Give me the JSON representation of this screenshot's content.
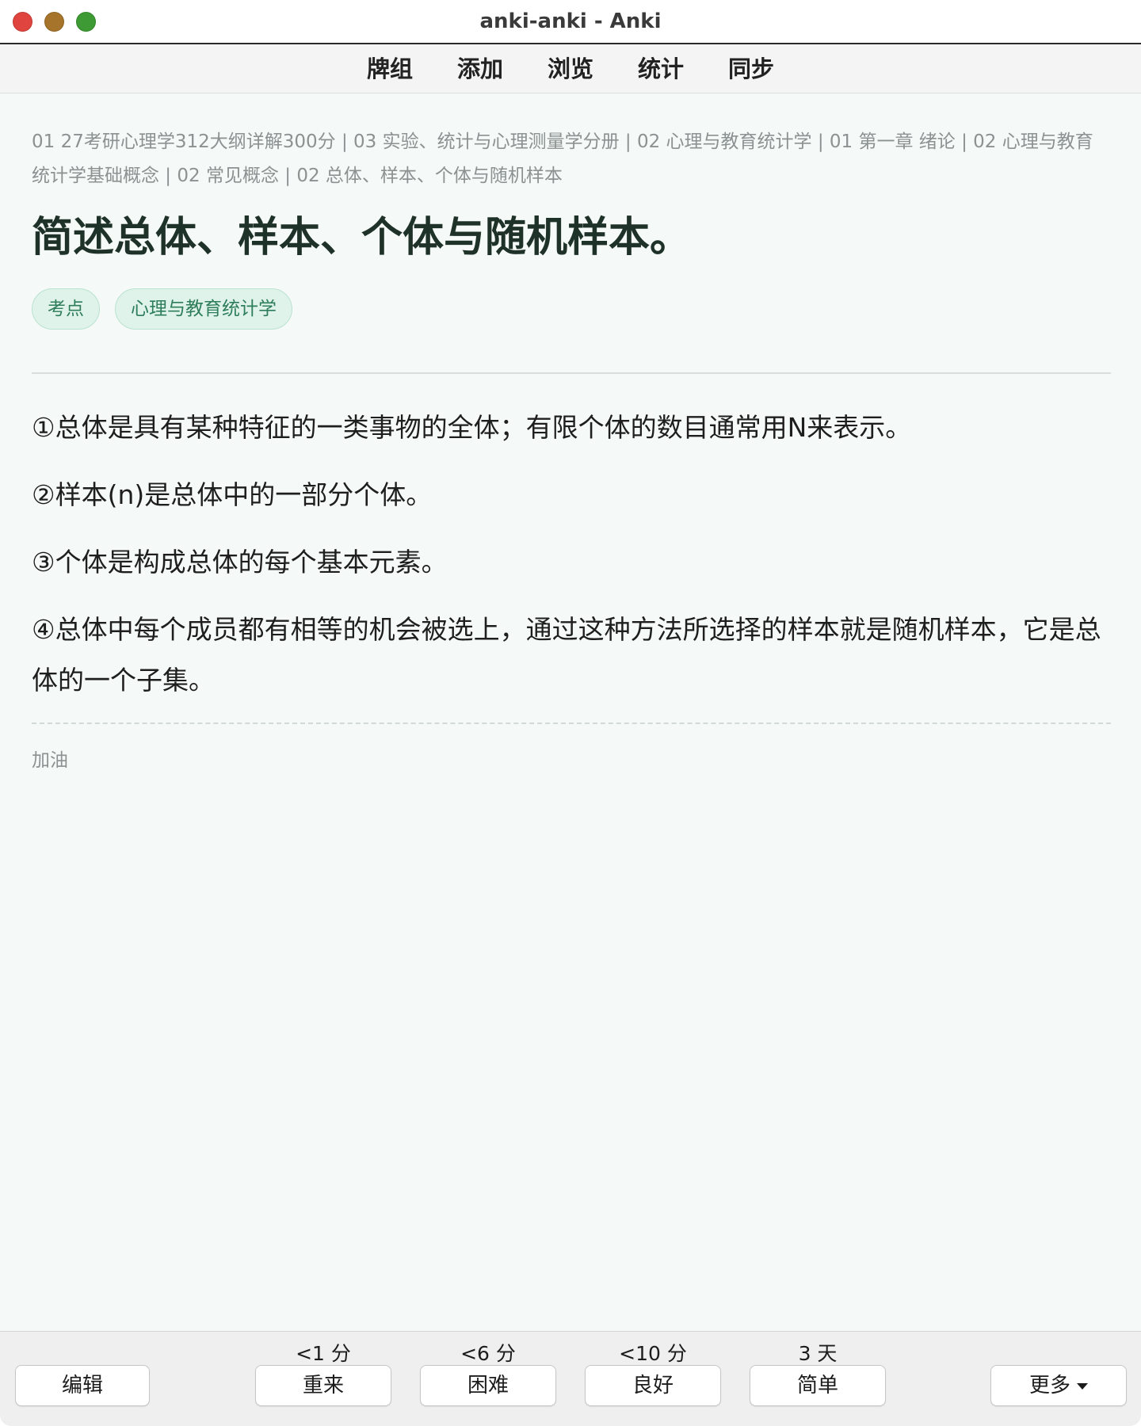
{
  "window": {
    "title": "anki-anki - Anki"
  },
  "toolbar": {
    "items": [
      {
        "label": "牌组"
      },
      {
        "label": "添加"
      },
      {
        "label": "浏览"
      },
      {
        "label": "统计"
      },
      {
        "label": "同步"
      }
    ]
  },
  "card": {
    "breadcrumb": "01 27考研心理学312大纲详解300分 | 03 实验、统计与心理测量学分册 | 02 心理与教育统计学 | 01 第一章 绪论 | 02 心理与教育统计学基础概念 | 02 常见概念 | 02 总体、样本、个体与随机样本",
    "question": "简述总体、样本、个体与随机样本。",
    "tags": [
      "考点",
      "心理与教育统计学"
    ],
    "answer": [
      "①总体是具有某种特征的一类事物的全体；有限个体的数目通常用N来表示。",
      "②样本(n)是总体中的一部分个体。",
      "③个体是构成总体的每个基本元素。",
      "④总体中每个成员都有相等的机会被选上，通过这种方法所选择的样本就是随机样本，它是总体的一个子集。"
    ],
    "note": "加油"
  },
  "bottombar": {
    "edit_label": "编辑",
    "answers": [
      {
        "label": "重来",
        "interval": "<1 分"
      },
      {
        "label": "困难",
        "interval": "<6 分"
      },
      {
        "label": "良好",
        "interval": "<10 分"
      },
      {
        "label": "简单",
        "interval": "3 天"
      }
    ],
    "more_label": "更多"
  },
  "colors": {
    "background": "#f5f9f8",
    "tag_bg": "#dff3ea",
    "tag_text": "#2e7d5b",
    "question_text": "#1f3229",
    "close": "#e0443e",
    "minimize": "#a6752b",
    "maximize": "#3e9a34"
  }
}
